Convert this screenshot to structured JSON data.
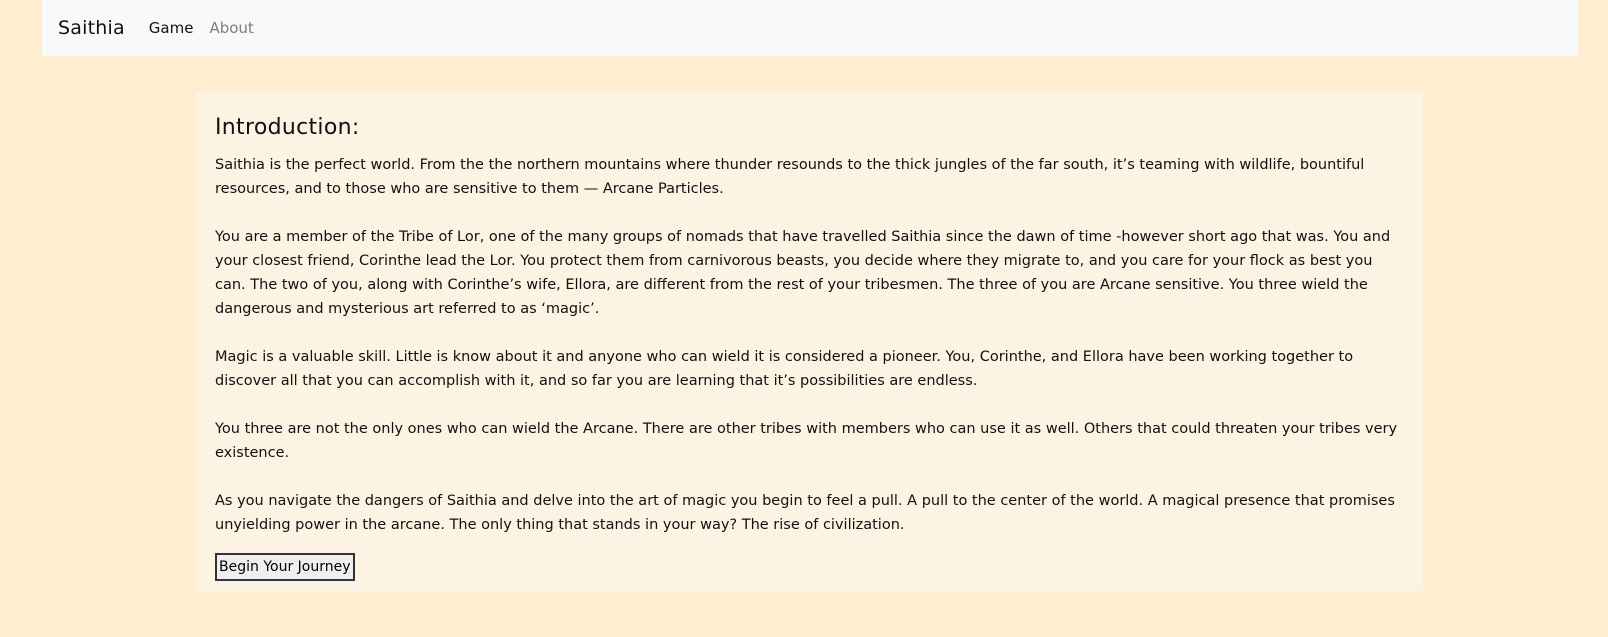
{
  "navbar": {
    "brand": "Saithia",
    "links": [
      {
        "label": "Game"
      },
      {
        "label": "About"
      }
    ]
  },
  "intro": {
    "heading": "Introduction:",
    "paragraphs": [
      "Saithia is the perfect world. From the the northern mountains where thunder resounds to the thick jungles of the far south, it’s teaming with wildlife, bountiful resources, and to those who are sensitive to them — Arcane Particles.",
      "You are a member of the Tribe of Lor, one of the many groups of nomads that have travelled Saithia since the dawn of time -however short ago that was. You and your closest friend, Corinthe lead the Lor. You protect them from carnivorous beasts, you decide where they migrate to, and you care for your flock as best you can. The two of you, along with Corinthe’s wife, Ellora, are different from the rest of your tribesmen. The three of you are Arcane sensitive. You three wield the dangerous and mysterious art referred to as ‘magic’.",
      "Magic is a valuable skill. Little is know about it and anyone who can wield it is considered a pioneer. You, Corinthe, and Ellora have been working together to discover all that you can accomplish with it, and so far you are learning that it’s possibilities are endless.",
      "You three are not the only ones who can wield the Arcane. There are other tribes with members who can use it as well. Others that could threaten your tribes very existence.",
      "As you navigate the dangers of Saithia and delve into the art of magic you begin to feel a pull. A pull to the center of the world. A magical presence that promises unyielding power in the arcane. The only thing that stands in your way? The rise of civilization."
    ],
    "button_label": "Begin Your Journey"
  }
}
